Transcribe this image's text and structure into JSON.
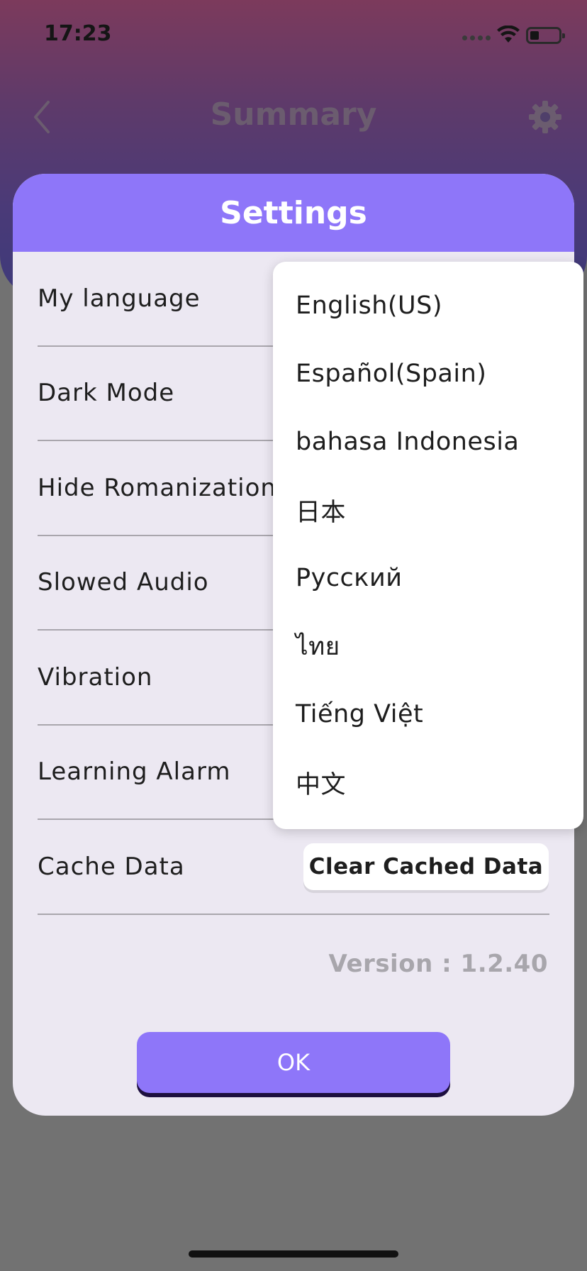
{
  "status_bar": {
    "time": "17:23"
  },
  "background": {
    "title": "Summary"
  },
  "modal": {
    "title": "Settings",
    "rows": [
      {
        "label": "My language"
      },
      {
        "label": "Dark Mode"
      },
      {
        "label": "Hide Romanization"
      },
      {
        "label": "Slowed Audio"
      },
      {
        "label": "Vibration"
      },
      {
        "label": "Learning Alarm"
      },
      {
        "label": "Cache Data"
      }
    ],
    "clear_cache_label": "Clear Cached Data",
    "version": "Version : 1.2.40",
    "ok_label": "OK"
  },
  "language_dropdown": {
    "options": [
      "English(US)",
      "Español(Spain)",
      "bahasa Indonesia",
      "日本",
      "Русский",
      "ไทย",
      "Tiếng Việt",
      "中文"
    ]
  },
  "colors": {
    "accent": "#8e76f9",
    "modal_bg": "#ece8f2",
    "ok_shadow": "#1d0f3f"
  }
}
